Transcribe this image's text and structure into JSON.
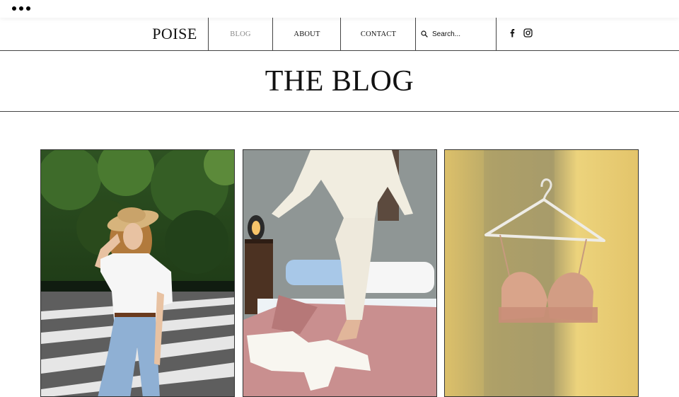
{
  "browser": {
    "menu_icon": "more-dots-icon"
  },
  "site": {
    "logo": "POISE"
  },
  "nav": {
    "items": [
      {
        "label": "BLOG",
        "active": true
      },
      {
        "label": "ABOUT",
        "active": false
      },
      {
        "label": "CONTACT",
        "active": false
      }
    ],
    "search_placeholder": "Search...",
    "search_icon": "search-icon",
    "social": [
      "facebook-icon",
      "instagram-icon"
    ]
  },
  "page": {
    "title": "THE BLOG"
  },
  "posts": [
    {
      "image": "woman in straw hat, white t-shirt and jeans on street"
    },
    {
      "image": "person in white pajamas stepping on a bed with pink blanket"
    },
    {
      "image": "pink lace bra on hanger against yellow wall"
    }
  ],
  "colors": {
    "text": "#111111",
    "active_nav": "#8a8a8a",
    "divider": "#444444",
    "background": "#ffffff"
  }
}
